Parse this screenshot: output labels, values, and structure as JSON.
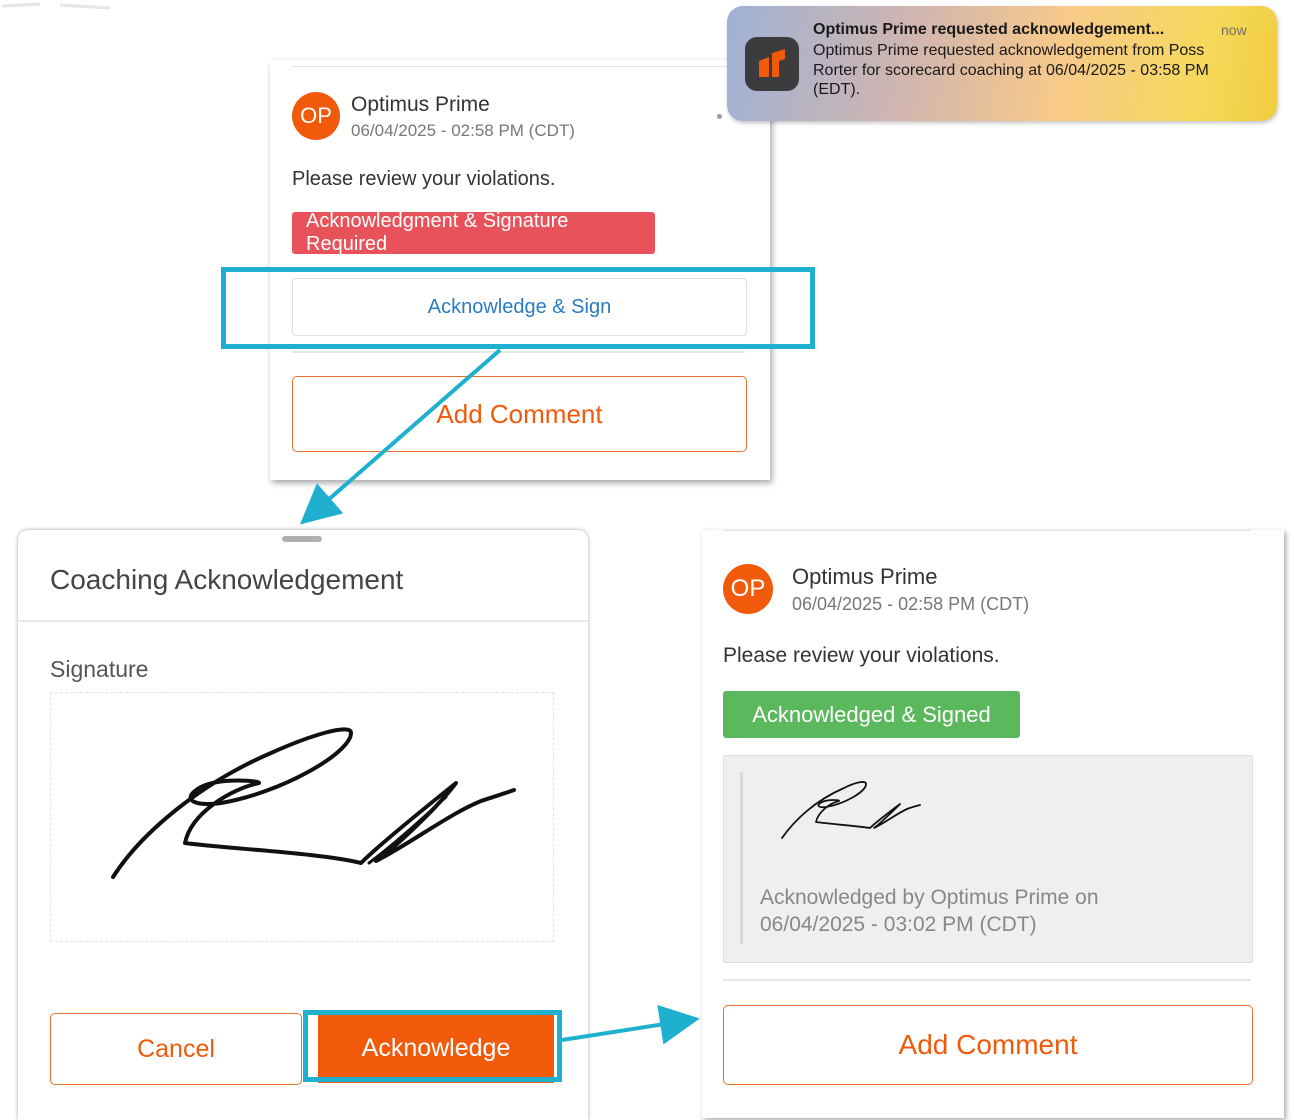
{
  "notification": {
    "title": "Optimus Prime requested acknowledgement...",
    "time": "now",
    "body": "Optimus Prime requested acknowledgement from Poss Rorter for scorecard coaching at 06/04/2025 - 03:58 PM (EDT)."
  },
  "coaching_card": {
    "avatar_initials": "OP",
    "author": "Optimus Prime",
    "timestamp": "06/04/2025 - 02:58 PM (CDT)",
    "message": "Please review your violations.",
    "status_badge": "Acknowledgment & Signature Required",
    "acknowledge_sign_label": "Acknowledge & Sign",
    "add_comment_label": "Add Comment"
  },
  "modal": {
    "title": "Coaching Acknowledgement",
    "signature_label": "Signature",
    "cancel_label": "Cancel",
    "acknowledge_label": "Acknowledge"
  },
  "result_card": {
    "avatar_initials": "OP",
    "author": "Optimus Prime",
    "timestamp": "06/04/2025 - 02:58 PM (CDT)",
    "message": "Please review your violations.",
    "status_badge": "Acknowledged & Signed",
    "ack_line1": "Acknowledged by Optimus Prime on",
    "ack_line2": "06/04/2025 - 03:02 PM (CDT)",
    "add_comment_label": "Add Comment"
  },
  "colors": {
    "accent_orange": "#f15a0a",
    "required_red": "#e8525a",
    "signed_green": "#5cb85c",
    "highlight_cyan": "#1fb0cf",
    "link_blue": "#2a7bc2"
  }
}
